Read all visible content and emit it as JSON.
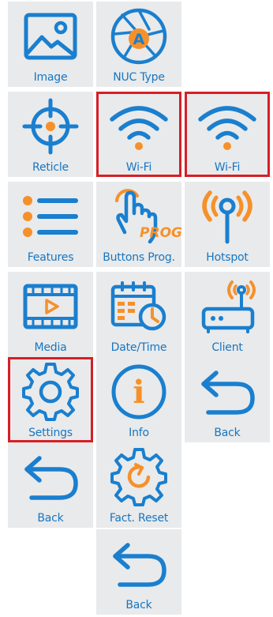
{
  "colors": {
    "tile_bg": "#e9eaeb",
    "accent_blue": "#1a7fcf",
    "accent_orange": "#f5912b",
    "selection_red": "#d61f26",
    "label_blue": "#1676c2"
  },
  "tiles": {
    "image": {
      "label": "Image",
      "icon": "image-icon"
    },
    "nuc_type": {
      "label": "NUC Type",
      "icon": "aperture-icon",
      "badge": "A"
    },
    "reticle": {
      "label": "Reticle",
      "icon": "crosshair-icon"
    },
    "wifi_1": {
      "label": "Wi-Fi",
      "icon": "wifi-icon"
    },
    "wifi_2": {
      "label": "Wi-Fi",
      "icon": "wifi-icon"
    },
    "features": {
      "label": "Features",
      "icon": "list-icon"
    },
    "buttons_prog": {
      "label": "Buttons Prog.",
      "icon": "tap-finger-icon",
      "badge": "PROG"
    },
    "hotspot": {
      "label": "Hotspot",
      "icon": "hotspot-icon"
    },
    "media": {
      "label": "Media",
      "icon": "film-icon"
    },
    "date_time": {
      "label": "Date/Time",
      "icon": "calendar-clock-icon"
    },
    "client": {
      "label": "Client",
      "icon": "router-icon"
    },
    "settings": {
      "label": "Settings",
      "icon": "gear-icon"
    },
    "info": {
      "label": "Info",
      "icon": "info-icon",
      "glyph": "i"
    },
    "back_1": {
      "label": "Back",
      "icon": "back-arrow-icon"
    },
    "back_2": {
      "label": "Back",
      "icon": "back-arrow-icon"
    },
    "fact_reset": {
      "label": "Fact. Reset",
      "icon": "gear-reset-icon"
    },
    "back_3": {
      "label": "Back",
      "icon": "back-arrow-icon"
    }
  }
}
